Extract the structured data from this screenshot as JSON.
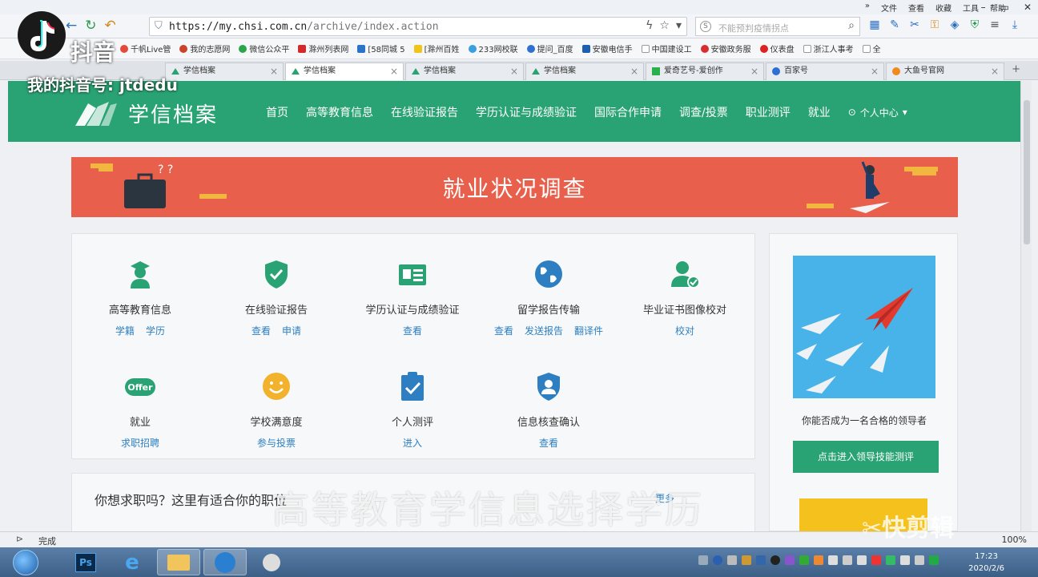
{
  "browser": {
    "menu": [
      "文件",
      "查看",
      "收藏",
      "工具",
      "帮助"
    ],
    "url_main": "https://my.chsi.com.cn",
    "url_rest": "/archive/index.action",
    "search_placeholder": "不能预判疫情拐点",
    "bookmarks": [
      "千帆Live管",
      "我的志愿网",
      "微信公众平",
      "滁州列表网",
      "[58同城 5",
      "[滁州百姓",
      "233网校联",
      "提问_百度",
      "安徽电信手",
      "中国建设工",
      "安徽政务服",
      "仪表盘",
      "浙江人事考",
      "全"
    ],
    "tabs": [
      "学信档案",
      "学信档案",
      "学信档案",
      "学信档案",
      "爱奇艺号-爱创作",
      "百家号",
      "大鱼号官网"
    ],
    "status": "完成",
    "zoom": "100%"
  },
  "site": {
    "logo": "学信档案",
    "nav": [
      "首页",
      "高等教育信息",
      "在线验证报告",
      "学历认证与成绩验证",
      "国际合作申请",
      "调查/投票",
      "职业测评",
      "就业"
    ],
    "user_center": "个人中心",
    "banner_title": "就业状况调查",
    "services": [
      {
        "name": "高等教育信息",
        "links": [
          "学籍",
          "学历"
        ]
      },
      {
        "name": "在线验证报告",
        "links": [
          "查看",
          "申请"
        ]
      },
      {
        "name": "学历认证与成绩验证",
        "links": [
          "查看"
        ]
      },
      {
        "name": "留学报告传输",
        "links": [
          "查看",
          "发送报告",
          "翻译件"
        ]
      },
      {
        "name": "毕业证书图像校对",
        "links": [
          "校对"
        ]
      },
      {
        "name": "就业",
        "links": [
          "求职招聘"
        ]
      },
      {
        "name": "学校满意度",
        "links": [
          "参与投票"
        ]
      },
      {
        "name": "个人测评",
        "links": [
          "进入"
        ]
      },
      {
        "name": "信息核查确认",
        "links": [
          "查看"
        ]
      }
    ],
    "offer_badge": "Offer",
    "side_caption": "你能否成为一名合格的领导者",
    "side_button": "点击进入领导技能测评",
    "jobs_title": "你想求职吗？这里有适合你的职位",
    "jobs_more": "更多"
  },
  "taskbar": {
    "ps_label": "Ps",
    "time": "17:23",
    "date": "2020/2/6"
  },
  "overlay": {
    "app_name": "抖音",
    "douyin_id": "我的抖音号: jtdedu",
    "subtitle": "高等教育学信息选择学历",
    "editor_watermark": "快剪辑"
  }
}
